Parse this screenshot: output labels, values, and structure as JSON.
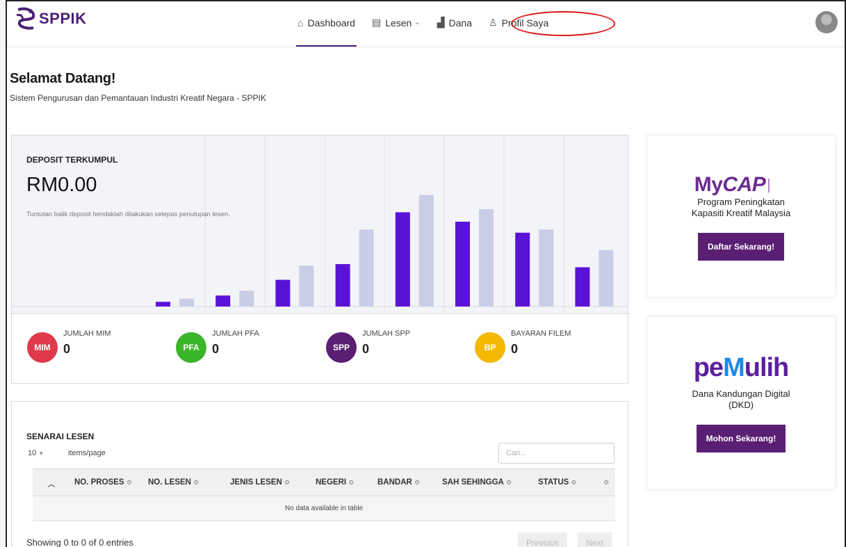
{
  "app": {
    "name": "SPPIK"
  },
  "nav": {
    "items": [
      {
        "label": "Dashboard",
        "icon": "home-icon",
        "active": true
      },
      {
        "label": "Lesen",
        "icon": "license-icon",
        "dropdown": true
      },
      {
        "label": "Dana",
        "icon": "fund-icon"
      },
      {
        "label": "Profil Saya",
        "icon": "user-icon"
      }
    ]
  },
  "page": {
    "title": "Selamat Datang!",
    "subtitle": "Sistem Pengurusan dan Pemantauan Industri Kreatif Negara - SPPIK"
  },
  "deposit": {
    "label": "DEPOSIT TERKUMPUL",
    "value": "RM0.00",
    "note": "Tuntutan balik deposit hendaklah dilakukan selepas penutupan lesen."
  },
  "chart_data": {
    "type": "bar",
    "series": [
      {
        "values": [
          3,
          7,
          17,
          27,
          60,
          54,
          47,
          25
        ],
        "color": "#5a12d6"
      },
      {
        "values": [
          5,
          10,
          26,
          49,
          71,
          62,
          49,
          36
        ],
        "color": "#c9cde6"
      }
    ],
    "ylim": [
      0,
      100
    ]
  },
  "counters": [
    {
      "badge": "MIM",
      "label": "JUMLAH MIM",
      "value": "0",
      "color": "#e0394b"
    },
    {
      "badge": "PFA",
      "label": "JUMLAH PFA",
      "value": "0",
      "color": "#3bb52a"
    },
    {
      "badge": "SPP",
      "label": "JUMLAH SPP",
      "value": "0",
      "color": "#5a1f73"
    },
    {
      "badge": "BP",
      "label": "BAYARAN FILEM",
      "value": "0",
      "color": "#f5b800"
    }
  ],
  "table": {
    "title": "SENARAI LESEN",
    "page_size": "10",
    "per_page_label": "items/page",
    "search_placeholder": "Cari...",
    "columns": [
      "NO. PROSES",
      "NO. LESEN",
      "JENIS LESEN",
      "NEGERI",
      "BANDAR",
      "SAH SEHINGGA",
      "STATUS"
    ],
    "empty": "No data available in table",
    "showing": "Showing 0 to 0 of 0 entries",
    "prev": "Previous",
    "next": "Next"
  },
  "promos": {
    "mycap": {
      "logo_a": "My",
      "logo_b": "CAP",
      "text_1": "Program Peningkatan",
      "text_2": "Kapasiti Kreatif Malaysia",
      "button": "Daftar Sekarang!"
    },
    "pemulih": {
      "logo_a": "pe",
      "logo_b": "M",
      "logo_c": "ulih",
      "text_1": "Dana Kandungan Digital",
      "text_2": "(DKD)",
      "button": "Mohon Sekarang!"
    }
  }
}
